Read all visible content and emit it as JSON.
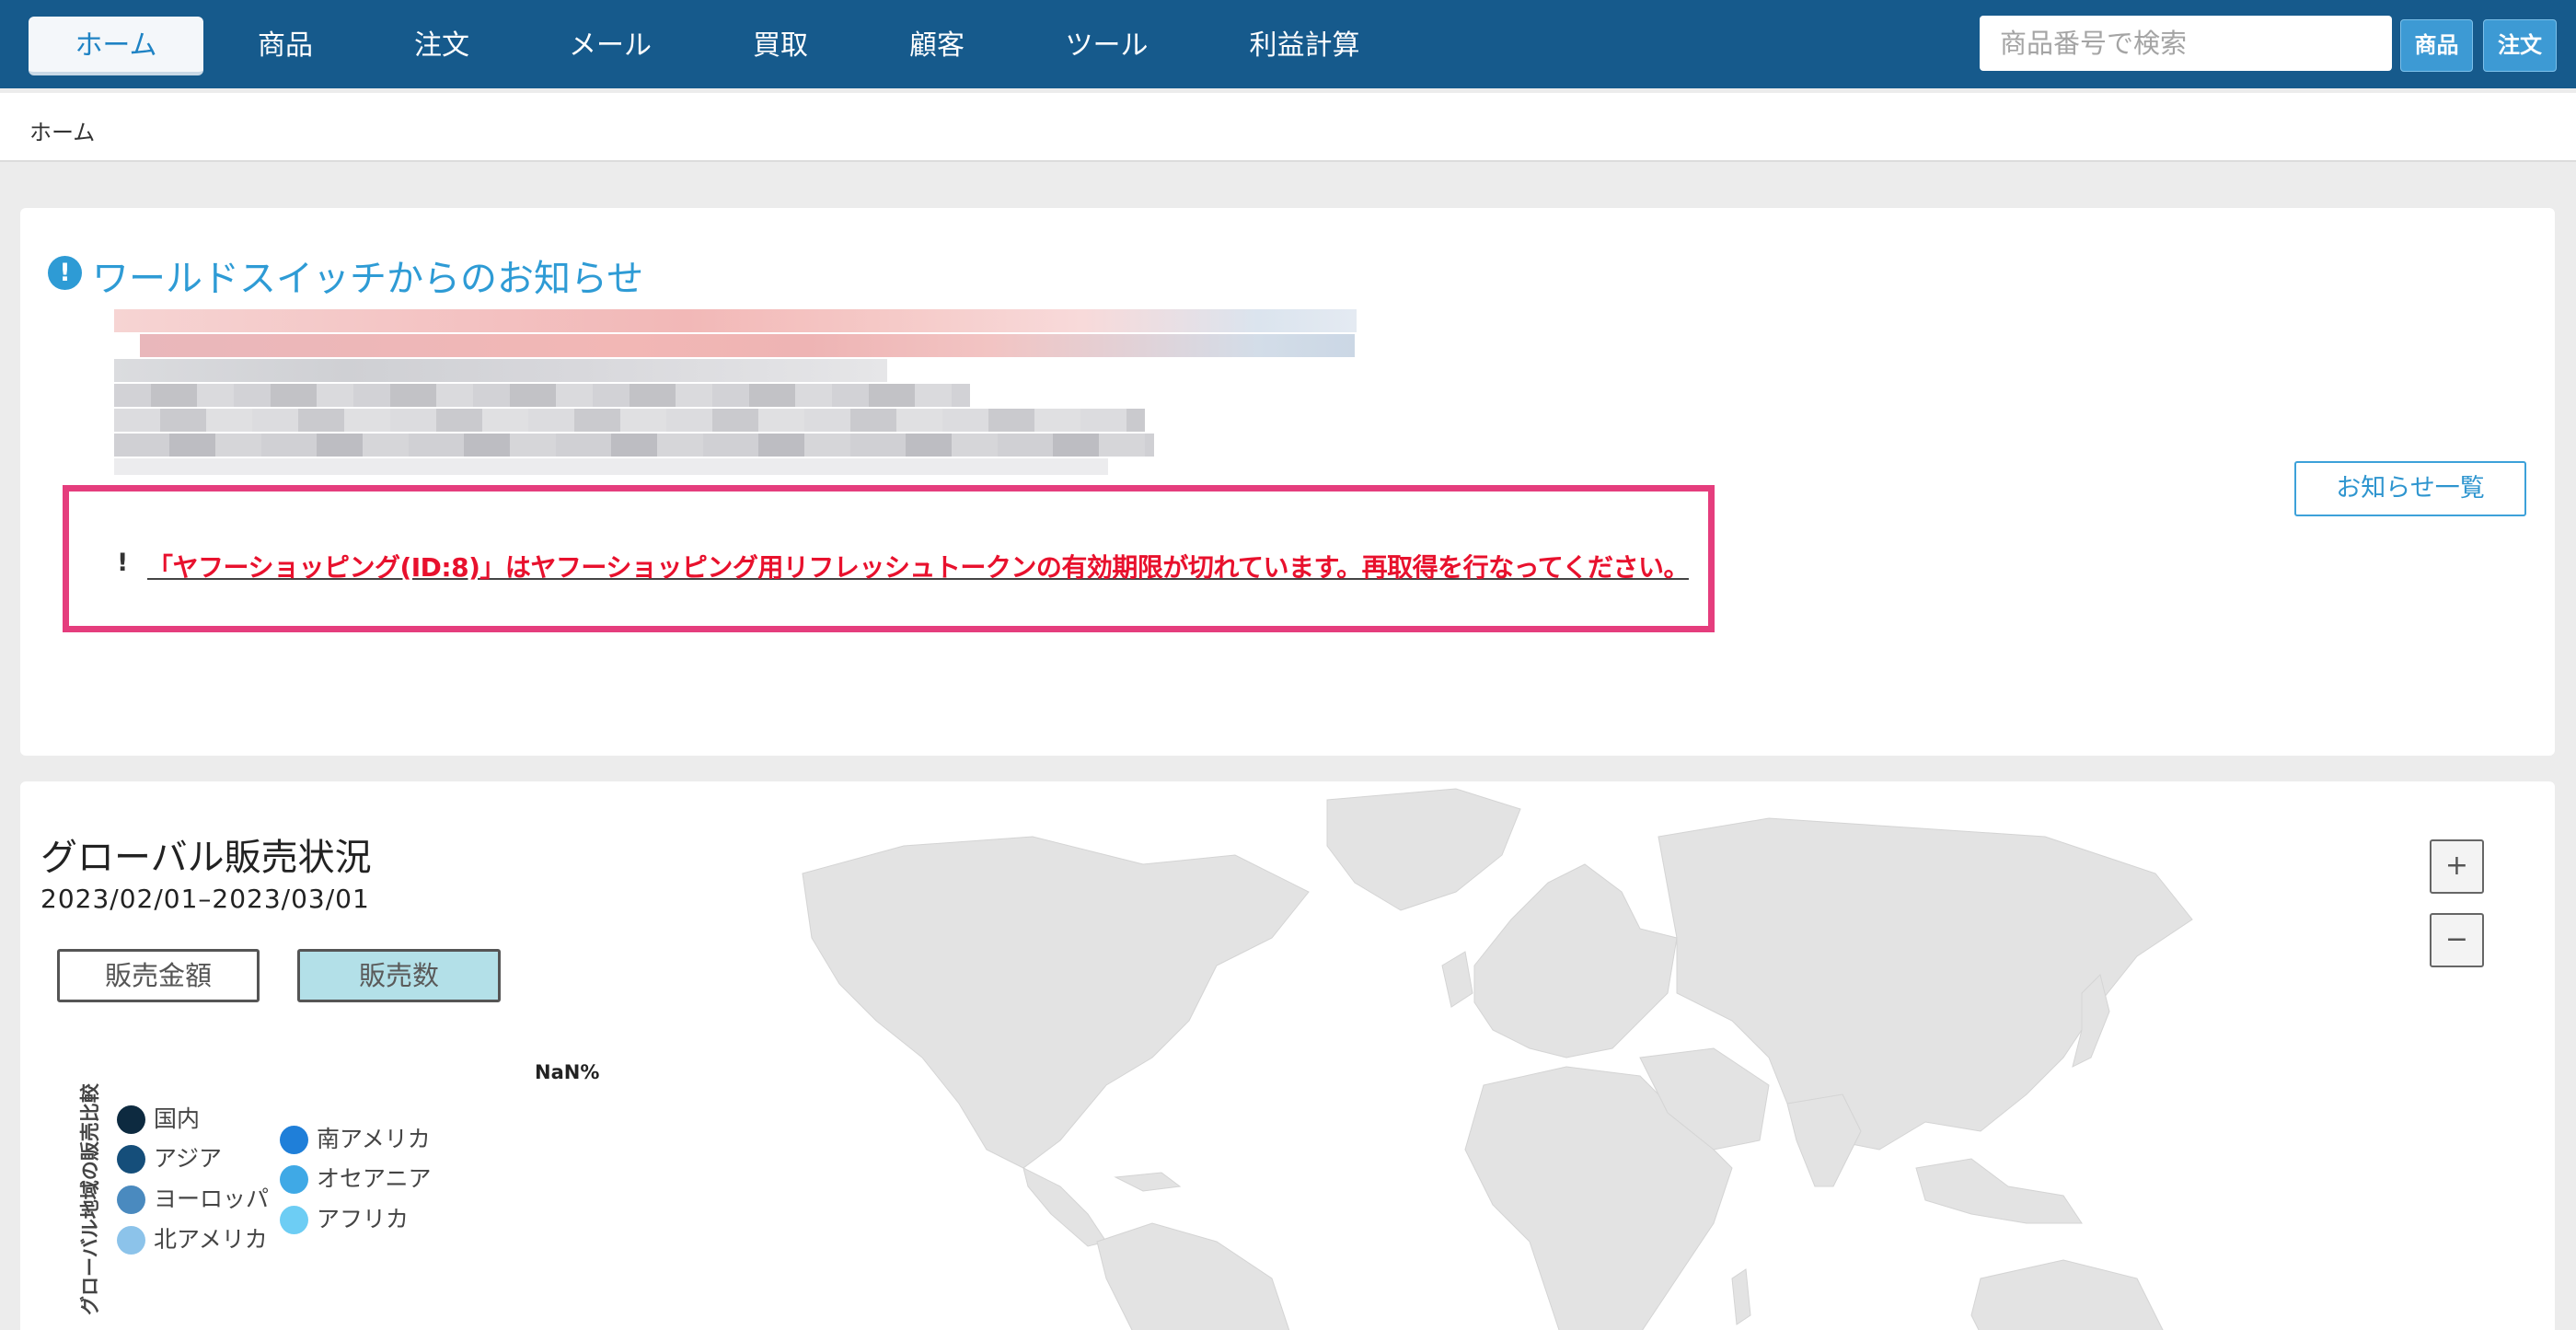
{
  "nav": {
    "tabs": [
      "ホーム",
      "商品",
      "注文",
      "メール",
      "買取",
      "顧客",
      "ツール",
      "利益計算"
    ],
    "active": "ホーム",
    "search_placeholder": "商品番号で検索",
    "search_value": "",
    "btn_product": "商品",
    "btn_order": "注文"
  },
  "breadcrumb": "ホーム",
  "news": {
    "title": "ワールドスイッチからのお知らせ",
    "alert_icon": "exclamation-circle-icon",
    "list_button": "お知らせ一覧",
    "warning_marker": "!",
    "warning_text": "「ヤフーショッピング(ID:8)」はヤフーショッピング用リフレッシュトークンの有効期限が切れています。再取得を行なってください。",
    "warning_color": "#e8112d",
    "highlight_box_color": "#e53d7d"
  },
  "sales_map": {
    "title": "グローバル販売状況",
    "period": "2023/02/01–2023/03/01",
    "toggles": [
      "販売金額",
      "販売数"
    ],
    "active_toggle": "販売数",
    "zoom_in": "+",
    "zoom_out": "−",
    "donut_value": "NaN%",
    "vertical_label": "グローバル地域の販売比較",
    "legend": [
      {
        "label": "国内",
        "color": "#0d2a40"
      },
      {
        "label": "アジア",
        "color": "#154e7a"
      },
      {
        "label": "ヨーロッパ",
        "color": "#4a8abf"
      },
      {
        "label": "北アメリカ",
        "color": "#8cc3ea"
      },
      {
        "label": "南アメリカ",
        "color": "#1f7fd9"
      },
      {
        "label": "オセアニア",
        "color": "#3fa9e6"
      },
      {
        "label": "アフリカ",
        "color": "#6dcdf4"
      }
    ],
    "map_color": "#e3e3e3"
  },
  "colors": {
    "nav_bg": "#165a8c",
    "accent": "#2e9bd5"
  }
}
